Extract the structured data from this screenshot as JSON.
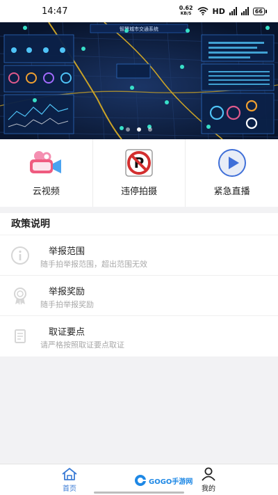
{
  "status_bar": {
    "time": "14:47",
    "net_speed_value": "0.62",
    "net_speed_unit": "KB/S",
    "hd": "HD",
    "battery": "66"
  },
  "banner": {
    "title": "智慧城市交通系统",
    "carousel_active_index": 1,
    "carousel_count": 3
  },
  "quick_actions": [
    {
      "label": "云视频",
      "icon": "camera-icon"
    },
    {
      "label": "违停拍摄",
      "icon": "no-parking-icon"
    },
    {
      "label": "紧急直播",
      "icon": "play-icon"
    }
  ],
  "policy": {
    "title": "政策说明",
    "items": [
      {
        "title": "举报范围",
        "subtitle": "随手拍举报范围，超出范围无效",
        "icon": "info-icon"
      },
      {
        "title": "举报奖励",
        "subtitle": "随手拍举报奖励",
        "icon": "award-icon"
      },
      {
        "title": "取证要点",
        "subtitle": "请严格按照取证要点取证",
        "icon": "document-icon"
      }
    ]
  },
  "tab_bar": {
    "home_label": "首页",
    "mine_label": "我的",
    "active": "home"
  },
  "watermark": {
    "text": "GOGO手游网"
  },
  "colors": {
    "accent": "#3a7bd5",
    "banner_bg": "#0b1b3a",
    "road_gold": "#c9a227"
  }
}
